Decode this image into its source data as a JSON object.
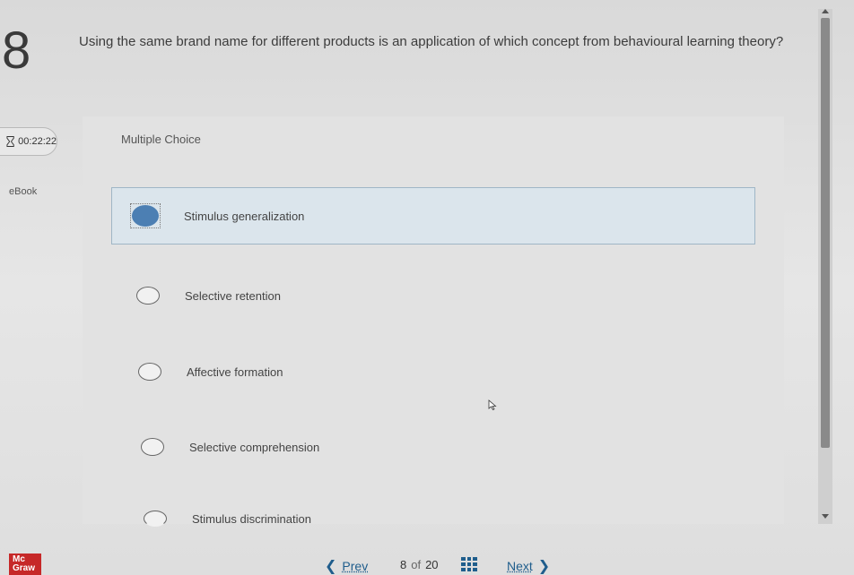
{
  "question": {
    "number": "8",
    "text": "Using the same brand name for different products is an application of which concept from behavioural learning theory?"
  },
  "timer": {
    "value": "00:22:22"
  },
  "sidebar": {
    "ebook_label": "eBook"
  },
  "question_type": "Multiple Choice",
  "choices": [
    {
      "label": "Stimulus generalization",
      "selected": true
    },
    {
      "label": "Selective retention",
      "selected": false
    },
    {
      "label": "Affective formation",
      "selected": false
    },
    {
      "label": "Selective comprehension",
      "selected": false
    },
    {
      "label": "Stimulus discrimination",
      "selected": false
    }
  ],
  "footer": {
    "logo_line1": "Mc",
    "logo_line2": "Graw",
    "prev_label": "Prev",
    "current_page": "8",
    "of_label": "of",
    "total_pages": "20",
    "next_label": "Next"
  },
  "colors": {
    "accent": "#1f5d8c",
    "selected_radio": "#4c7fb3",
    "logo": "#c62828"
  }
}
